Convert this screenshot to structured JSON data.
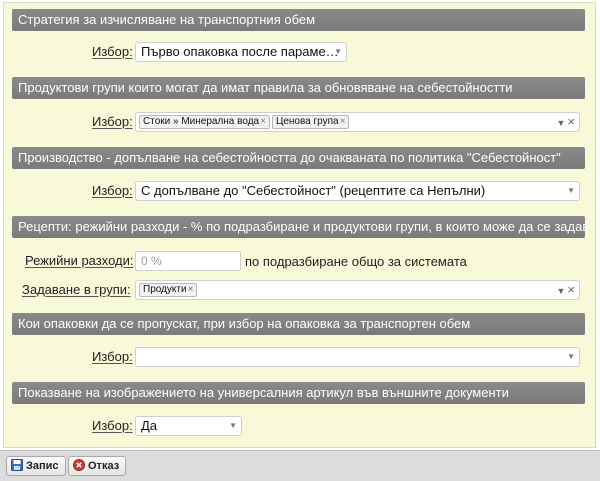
{
  "sections": [
    {
      "title": "Стратегия за изчисляване на транспортния обем",
      "label": "Избор:",
      "value": "Първо опаковка после параме…"
    },
    {
      "title": "Продуктови групи които могат да имат правила за обновяване на себестойностти",
      "label": "Избор:",
      "tags": [
        "Стоки » Минерална вода",
        "Ценова група"
      ]
    },
    {
      "title": "Производство - допълване на себестойността до очакваната по политика \"Себестойност\"",
      "label": "Избор:",
      "value": "С допълване до \"Себестойност\" (рецептите са Непълни)"
    },
    {
      "title": "Рецепти: режийни разходи - % по подразбиране и продуктови групи, в които може да се задава",
      "overhead_label": "Режийни разходи:",
      "overhead_placeholder": "0 %",
      "overhead_note": "по подразбиране общо за системата",
      "groups_label": "Задаване в групи:",
      "groups_tags": [
        "Продукти"
      ]
    },
    {
      "title": "Кои опаковки да се пропускат, при избор на опаковка за транспортен обем",
      "label": "Избор:",
      "value": ""
    },
    {
      "title": "Показване на изображението на универсалния артикул във външните документи",
      "label": "Избор:",
      "value": "Да"
    }
  ],
  "tag_remove_glyph": "×",
  "select_arrow_glyph": "▼",
  "clear_glyph": "×",
  "footer": {
    "save_label": "Запис",
    "cancel_label": "Отказ"
  },
  "colors": {
    "panel_bg": "#f8f9d8",
    "section_header_bg": "#808080",
    "footer_bg": "#dcdcdc",
    "save_icon": "#3b6fb6",
    "cancel_icon": "#d03a2a"
  },
  "icons": {
    "save": "floppy-disk-icon",
    "cancel": "cancel-circle-icon"
  }
}
